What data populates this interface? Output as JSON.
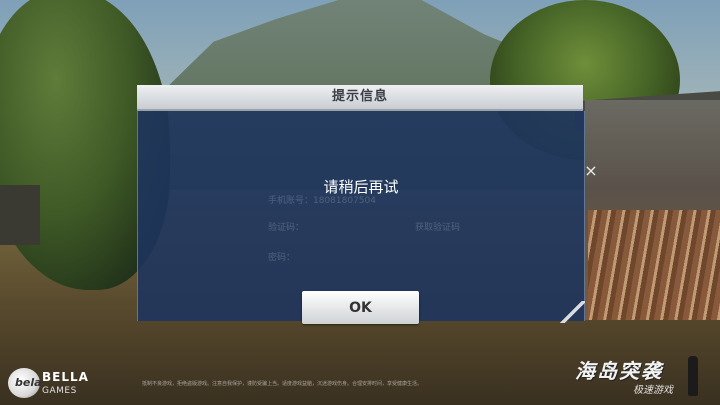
{
  "dialog": {
    "title": "提示信息",
    "message": "请稍后再试",
    "ok_label": "OK"
  },
  "background_form": {
    "phone_label": "手机账号：18081807504",
    "code_label": "验证码：",
    "get_code_label": "获取验证码",
    "password_label": "密码："
  },
  "close_icon": "×",
  "brand": {
    "logo_text": "bela",
    "name": "BELLA",
    "sub": "GAMES"
  },
  "footer_notice": "抵制不良游戏，拒绝盗版游戏。注意自我保护，谨防受骗上当。适度游戏益脑，沉迷游戏伤身。合理安排时间，享受健康生活。",
  "game_logo": {
    "title": "海岛突袭",
    "subtitle": "极速游戏"
  },
  "colors": {
    "dialog_header": "#dfe2e6",
    "dialog_body": "#1e3460",
    "ok_button": "#eceef0"
  }
}
